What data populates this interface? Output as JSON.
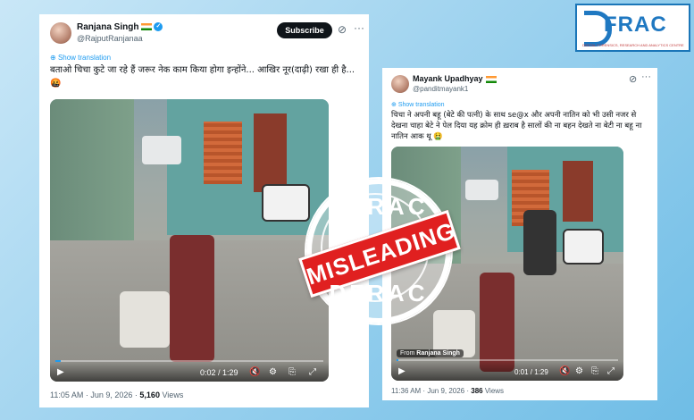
{
  "tweet1": {
    "author_name": "Ranjana Singh",
    "handle": "@RajputRanjanaa",
    "subscribe_label": "Subscribe",
    "show_translation": "Show translation",
    "text": "बताओ चिचा कुटे जा रहे हैं जरूर नेक काम किया होगा इन्होंने... आखिर नूर(दाढ़ी) रखा ही है...🤬",
    "video_time": "0:02 / 1:29",
    "video_progress_fraction": 0.02,
    "time": "11:05 AM · Jun 9, 2026 ·",
    "views_count": "5,160",
    "views_label": "Views"
  },
  "tweet2": {
    "author_name": "Mayank Upadhyay",
    "handle": "@panditmayank1",
    "show_translation": "Show translation",
    "text": "चिचा ने अपनी बहू (बेटे की पत्नी) के साथ se@x और अपनी नातिन को भी उसी नजर से देखना चाहा बेटे ने पेल दिया यह क्रोम ही ख़राब है सालों की ना बहन देखते ना बेटी ना बहू ना नातिन आक थू 🤮",
    "from_label": "From",
    "from_name": "Ranjana Singh",
    "video_time": "0:01 / 1:29",
    "video_progress_fraction": 0.01,
    "time": "11:36 AM · Jun 9, 2026 ·",
    "views_count": "386",
    "views_label": "Views"
  },
  "stamp": {
    "top": "DFRAC",
    "banner": "MISLEADING",
    "bottom": "DFRAC"
  },
  "logo": {
    "text": "FRAC",
    "subtitle": "DIGITAL FORENSICS, RESEARCH AND ANALYTICS CENTRE"
  }
}
